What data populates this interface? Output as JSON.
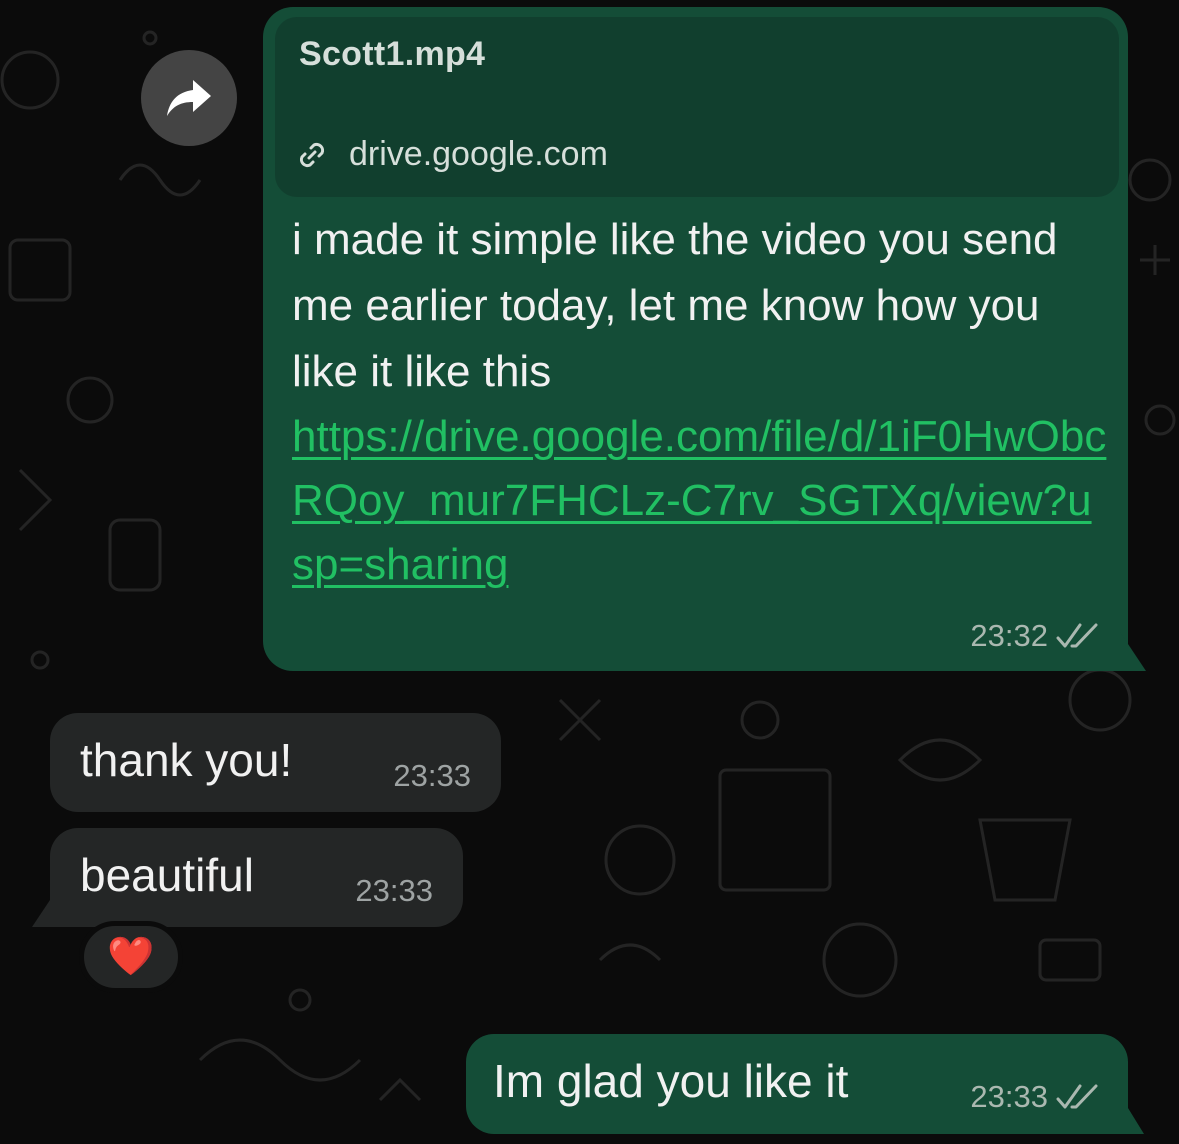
{
  "chat": {
    "messages": [
      {
        "direction": "outgoing",
        "link_preview": {
          "title": "Scott1.mp4",
          "domain": "drive.google.com",
          "icon": "link-icon"
        },
        "text": "i made it simple like the video you send me earlier today, let me know how you like it like this",
        "link": "https://drive.google.com/file/d/1iF0HwObcRQoy_mur7FHCLz-C7rv_SGTXq/view?usp=sharing",
        "time": "23:32",
        "status_icon": "double-check-icon"
      },
      {
        "direction": "incoming",
        "text": "thank you!",
        "time": "23:33"
      },
      {
        "direction": "incoming",
        "text": "beautiful",
        "time": "23:33",
        "reaction": "❤️"
      },
      {
        "direction": "outgoing",
        "text": "Im glad you like it",
        "time": "23:33",
        "status_icon": "double-check-icon"
      }
    ]
  },
  "colors": {
    "background": "#0b0b0b",
    "outgoing_bubble": "#144d37",
    "incoming_bubble": "#242626",
    "link": "#21c063",
    "preview_bg": "#113f2e"
  }
}
